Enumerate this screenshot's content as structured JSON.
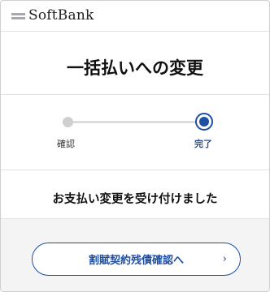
{
  "header": {
    "logo_text": "SoftBank"
  },
  "main": {
    "title": "一括払いへの変更",
    "steps": [
      {
        "label": "確認",
        "state": "done"
      },
      {
        "label": "完了",
        "state": "current"
      }
    ],
    "message": "お支払い変更を受け付けました"
  },
  "footer": {
    "cta_label": "割賦契約残債確認へ",
    "cta_icon": "chevron-right-icon"
  },
  "colors": {
    "accent": "#1e4fa0",
    "inactive": "#cfcfcf"
  }
}
